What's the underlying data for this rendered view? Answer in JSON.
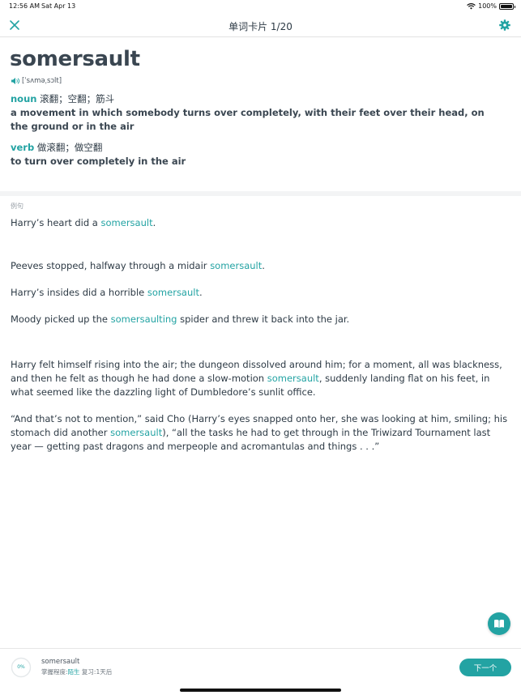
{
  "status_bar": {
    "time": "12:56 AM",
    "date": "Sat Apr 13",
    "battery": "100%"
  },
  "nav": {
    "title": "单词卡片 1/20",
    "close_icon": "close-icon",
    "settings_icon": "gear-icon"
  },
  "word": {
    "headword": "somersault",
    "phonetic": "[ˈsʌməˌsɔlt]",
    "definitions": [
      {
        "pos": "noun",
        "cn": "滚翻；空翻；筋斗",
        "en": "a movement in which somebody turns over completely, with their feet over their head, on the ground or in the air"
      },
      {
        "pos": "verb",
        "cn": "做滚翻；做空翻",
        "en": "to turn over completely in the air"
      }
    ]
  },
  "examples": {
    "label": "例句",
    "items": [
      {
        "before": "Harry’s heart did a ",
        "hl": "somersault",
        "after": "."
      },
      {
        "before": "Peeves stopped, halfway through a midair ",
        "hl": "somersault",
        "after": "."
      },
      {
        "before": "Harry’s insides did a horrible ",
        "hl": "somersault",
        "after": "."
      },
      {
        "before": "Moody picked up the ",
        "hl": "somersaulting",
        "after": " spider and threw it back into the jar."
      },
      {
        "before": "Harry felt himself rising into the air; the dungeon dissolved around him; for a moment, all was blackness, and then he felt as though he had done a slow-motion ",
        "hl": "somersault",
        "after": ", suddenly landing flat on his feet, in what seemed like the dazzling light of Dumbledore’s sunlit office."
      },
      {
        "before": "“And that’s not to mention,” said Cho (Harry’s eyes snapped onto her, she was looking at him, smiling; his stomach did another ",
        "hl": "somersault",
        "after": "), “all the tasks he had to get through in the Triwizard Tournament last year — getting past dragons and merpeople and acromantulas and things . . .”"
      }
    ]
  },
  "bottom": {
    "progress": "0%",
    "word": "somersault",
    "mastery_label": "掌握程度:",
    "mastery_value": "陌生",
    "review": " 复习:1天后",
    "next_label": "下一个"
  },
  "colors": {
    "accent": "#23a3a3",
    "text": "#2d3a45"
  }
}
